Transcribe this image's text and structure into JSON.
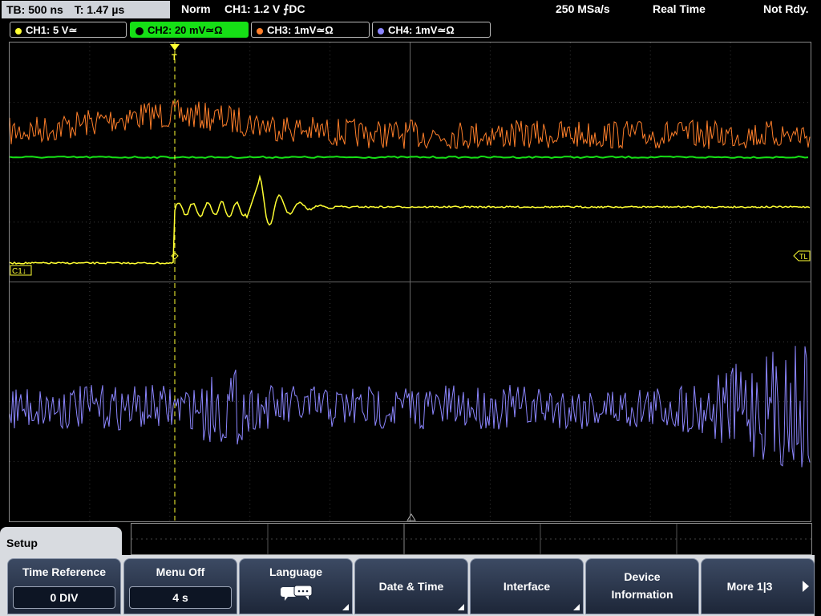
{
  "status": {
    "timebase": "TB: 500 ns",
    "trigger_time": "T: 1.47 µs",
    "mode": "Norm",
    "trigger_info": "CH1: 1.2 V ⨍DC",
    "sample_rate": "250 MSa/s",
    "acquisition": "Real Time",
    "readiness": "Not Rdy."
  },
  "channels": [
    {
      "label": "CH1: 5 V≃",
      "color": "#ffff33"
    },
    {
      "label": "CH2: 20 mV≃Ω",
      "color": "#16e016",
      "active": true
    },
    {
      "label": "CH3: 1mV≃Ω",
      "color": "#ff7f2a"
    },
    {
      "label": "CH4: 1mV≃Ω",
      "color": "#8c86ff"
    }
  ],
  "plot": {
    "ch1_marker": "C1↓",
    "trigger_level_marker": "TL",
    "trigger_pos_marker": "T"
  },
  "menu": {
    "title": "Setup",
    "softkeys": [
      {
        "label": "Time Reference",
        "value": "0 DIV"
      },
      {
        "label": "Menu Off",
        "value": "4 s"
      },
      {
        "label": "Language",
        "icon": "speech-bubbles-icon"
      },
      {
        "label": "Date & Time"
      },
      {
        "label": "Interface"
      },
      {
        "label_line1": "Device",
        "label_line2": "Information"
      },
      {
        "label": "More 1|3"
      }
    ]
  }
}
